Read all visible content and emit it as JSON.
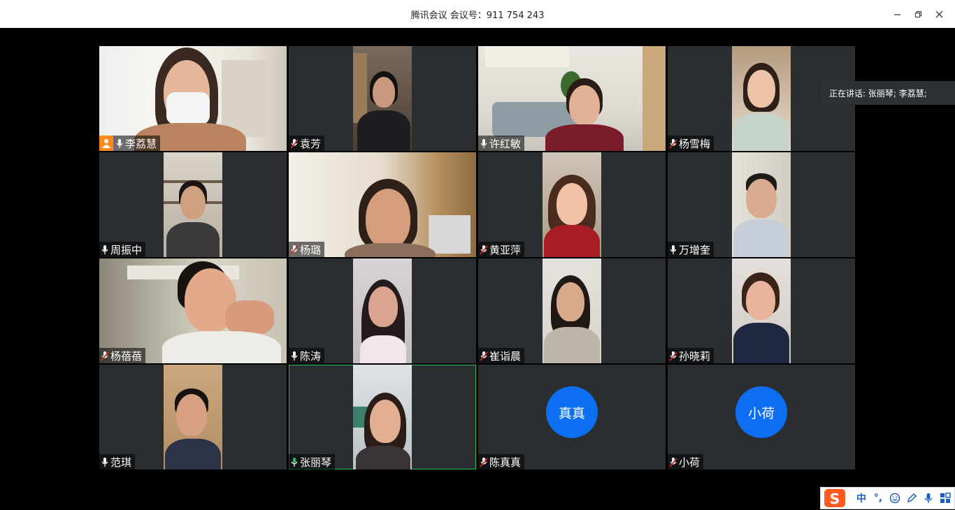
{
  "window": {
    "title": "腾讯会议 会议号：911 754 243",
    "controls": [
      "minimize",
      "restore",
      "close"
    ]
  },
  "speaking_indicator": "正在讲话: 张丽琴; 李荔慧;",
  "participants": [
    {
      "name": "李荔慧",
      "mic": "on",
      "host": true
    },
    {
      "name": "袁芳",
      "mic": "muted"
    },
    {
      "name": "许红敏",
      "mic": "on"
    },
    {
      "name": "杨雪梅",
      "mic": "muted"
    },
    {
      "name": "周振中",
      "mic": "on"
    },
    {
      "name": "杨璐",
      "mic": "muted"
    },
    {
      "name": "黄亚萍",
      "mic": "muted"
    },
    {
      "name": "万增奎",
      "mic": "on"
    },
    {
      "name": "杨蓓蓓",
      "mic": "muted"
    },
    {
      "name": "陈涛",
      "mic": "on"
    },
    {
      "name": "崔诣晨",
      "mic": "muted"
    },
    {
      "name": "孙晓莉",
      "mic": "muted"
    },
    {
      "name": "范琪",
      "mic": "on"
    },
    {
      "name": "张丽琴",
      "mic": "speaking",
      "active": true
    },
    {
      "name": "陈真真",
      "mic": "muted",
      "avatar_text": "真真",
      "avatar_color": "#0c6ff2"
    },
    {
      "name": "小荷",
      "mic": "muted",
      "avatar_text": "小荷",
      "avatar_color": "#0c6ff2"
    }
  ],
  "ime_toolbar": {
    "mode_label": "中",
    "punct_label": "°,",
    "icons": [
      "sogou-logo",
      "emoji-icon",
      "pen-icon",
      "voice-icon",
      "toolbox-icon"
    ]
  },
  "colors": {
    "tile_bg": "#2b2e31",
    "avatar_blue": "#0c6ff2",
    "speaking_green": "#22c15e",
    "host_orange": "#ff8a1f",
    "muted_red": "#e0302a"
  }
}
